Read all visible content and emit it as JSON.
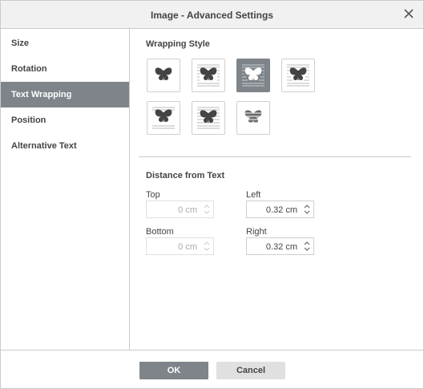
{
  "dialog": {
    "title": "Image - Advanced Settings"
  },
  "sidebar": {
    "items": [
      {
        "label": "Size"
      },
      {
        "label": "Rotation"
      },
      {
        "label": "Text Wrapping"
      },
      {
        "label": "Position"
      },
      {
        "label": "Alternative Text"
      }
    ],
    "active_index": 2
  },
  "wrapping": {
    "title": "Wrapping Style",
    "styles": [
      {
        "name": "inline",
        "selected": false
      },
      {
        "name": "square",
        "selected": false
      },
      {
        "name": "tight",
        "selected": true
      },
      {
        "name": "through",
        "selected": false
      },
      {
        "name": "top-and-bottom",
        "selected": false
      },
      {
        "name": "in-front",
        "selected": false
      },
      {
        "name": "behind",
        "selected": false
      }
    ]
  },
  "distance": {
    "title": "Distance from Text",
    "top": {
      "label": "Top",
      "value": "0 cm",
      "enabled": false
    },
    "left": {
      "label": "Left",
      "value": "0.32 cm",
      "enabled": true
    },
    "bottom": {
      "label": "Bottom",
      "value": "0 cm",
      "enabled": false
    },
    "right": {
      "label": "Right",
      "value": "0.32 cm",
      "enabled": true
    }
  },
  "footer": {
    "ok_label": "OK",
    "cancel_label": "Cancel"
  },
  "colors": {
    "accent": "#7e848a",
    "border": "#cbcbcb",
    "titlebar_bg": "#f1f1f1"
  }
}
